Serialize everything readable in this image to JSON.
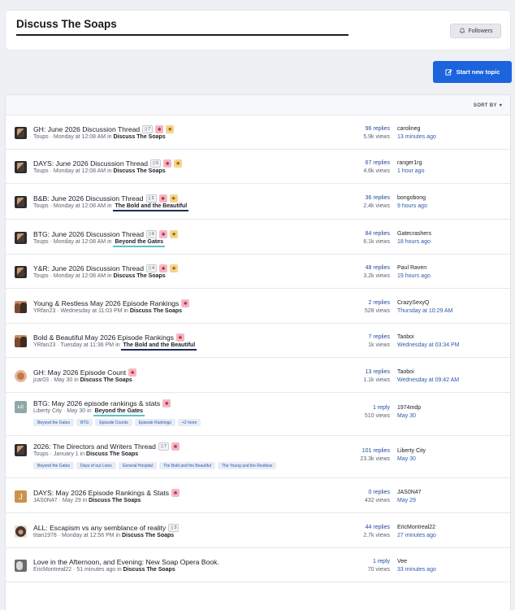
{
  "header": {
    "title": "Discuss The Soaps",
    "followers_label": "Followers"
  },
  "actions": {
    "start_new_topic": "Start new topic"
  },
  "list": {
    "sort_label": "SORT BY"
  },
  "topics": [
    {
      "title": "GH: June 2026 Discussion Thread",
      "count": "7",
      "pinned": true,
      "starred": true,
      "author": "Toups",
      "when": "Monday at 12:08 AM",
      "section": "Discuss The Soaps",
      "replies": "96 replies",
      "views": "5.9k views",
      "last_user": "carolineg",
      "last_time": "13 minutes ago"
    },
    {
      "title": "DAYS: June 2026 Discussion Thread",
      "count": "5",
      "pinned": true,
      "starred": true,
      "author": "Toups",
      "when": "Monday at 12:08 AM",
      "section": "Discuss The Soaps",
      "replies": "67 replies",
      "views": "4.6k views",
      "last_user": "ranger1rg",
      "last_time": "1 hour ago"
    },
    {
      "title": "B&B: June 2026 Discussion Thread",
      "count": "3",
      "pinned": true,
      "starred": true,
      "author": "Toups",
      "when": "Monday at 12:08 AM",
      "section": "The Bold and the Beautiful",
      "replies": "36 replies",
      "views": "2.4k views",
      "last_user": "bongobong",
      "last_time": "9 hours ago"
    },
    {
      "title": "BTG: June 2026 Discussion Thread",
      "count": "6",
      "pinned": true,
      "starred": true,
      "author": "Toups",
      "when": "Monday at 12:08 AM",
      "section": "Beyond the Gates",
      "replies": "84 replies",
      "views": "6.1k views",
      "last_user": "Gatecrashers",
      "last_time": "18 hours ago"
    },
    {
      "title": "Y&R: June 2026 Discussion Thread",
      "count": "4",
      "pinned": true,
      "starred": true,
      "author": "Toups",
      "when": "Monday at 12:08 AM",
      "section": "Discuss The Soaps",
      "replies": "48 replies",
      "views": "3.2k views",
      "last_user": "Paul Raven",
      "last_time": "19 hours ago"
    },
    {
      "title": "Young & Restless May 2026 Episode Rankings",
      "pinned": true,
      "author": "YRfan23",
      "when": "Wednesday at 11:03 PM",
      "section": "Discuss The Soaps",
      "replies": "2 replies",
      "views": "528 views",
      "last_user": "CrazySexyQ",
      "last_time": "Thursday at 10:29 AM"
    },
    {
      "title": "Bold & Beautiful May 2026 Episode Rankings",
      "pinned": true,
      "author": "YRfan23",
      "when": "Tuesday at 11:36 PM",
      "section": "The Bold and the Beautiful",
      "replies": "7 replies",
      "views": "1k views",
      "last_user": "Taoboi",
      "last_time": "Wednesday at 03:34 PM"
    },
    {
      "title": "GH: May 2026 Episode Count",
      "pinned": true,
      "author": "jcar03",
      "when": "May 30",
      "section": "Discuss The Soaps",
      "replies": "13 replies",
      "views": "1.1k views",
      "last_user": "Taoboi",
      "last_time": "Wednesday at 09:42 AM"
    },
    {
      "title": "BTG: May 2026 episode rankings & stats",
      "pinned": true,
      "author": "Liberty City",
      "when": "May 30",
      "section": "Beyond the Gates",
      "replies": "1 reply",
      "views": "510 views",
      "last_user": "1974mdp",
      "last_time": "May 30",
      "tags": [
        "Beyond the Gates",
        "BTG",
        "Episode Counts",
        "Episode Rankings",
        "+2 more"
      ]
    },
    {
      "title": "2026: The Directors and Writers Thread",
      "count": "7",
      "pinned": true,
      "author": "Toups",
      "when": "January 1",
      "section": "Discuss The Soaps",
      "replies": "101 replies",
      "views": "23.3k views",
      "last_user": "Liberty City",
      "last_time": "May 30",
      "tags": [
        "Beyond the Gates",
        "Days of our Lives",
        "General Hospital",
        "The Bold and the Beautiful",
        "The Young and the Restless"
      ]
    },
    {
      "title": "DAYS: May 2026 Episode Rankings & Stats",
      "pinned": true,
      "author": "JAS0N47",
      "when": "May 29",
      "section": "Discuss The Soaps",
      "replies": "0 replies",
      "views": "432 views",
      "last_user": "JAS0N47",
      "last_time": "May 29",
      "avatar_letter": "J"
    },
    {
      "title": "ALL: Escapism vs any semblance of reality",
      "count": "3",
      "author": "titan1978",
      "when": "Monday at 12:56 PM",
      "section": "Discuss The Soaps",
      "replies": "44 replies",
      "views": "2.7k views",
      "last_user": "EricMontreal22",
      "last_time": "27 minutes ago"
    },
    {
      "title": "Love in the Afternoon, and Evening: New Soap Opera Book.",
      "author": "EricMontreal22",
      "when": "51 minutes ago",
      "section": "Discuss The Soaps",
      "replies": "1 reply",
      "views": "70 views",
      "last_user": "Vee",
      "last_time": "33 minutes ago"
    }
  ],
  "avatar_lc_text": "LC",
  "meta_sep": " · ",
  "meta_in": " in "
}
